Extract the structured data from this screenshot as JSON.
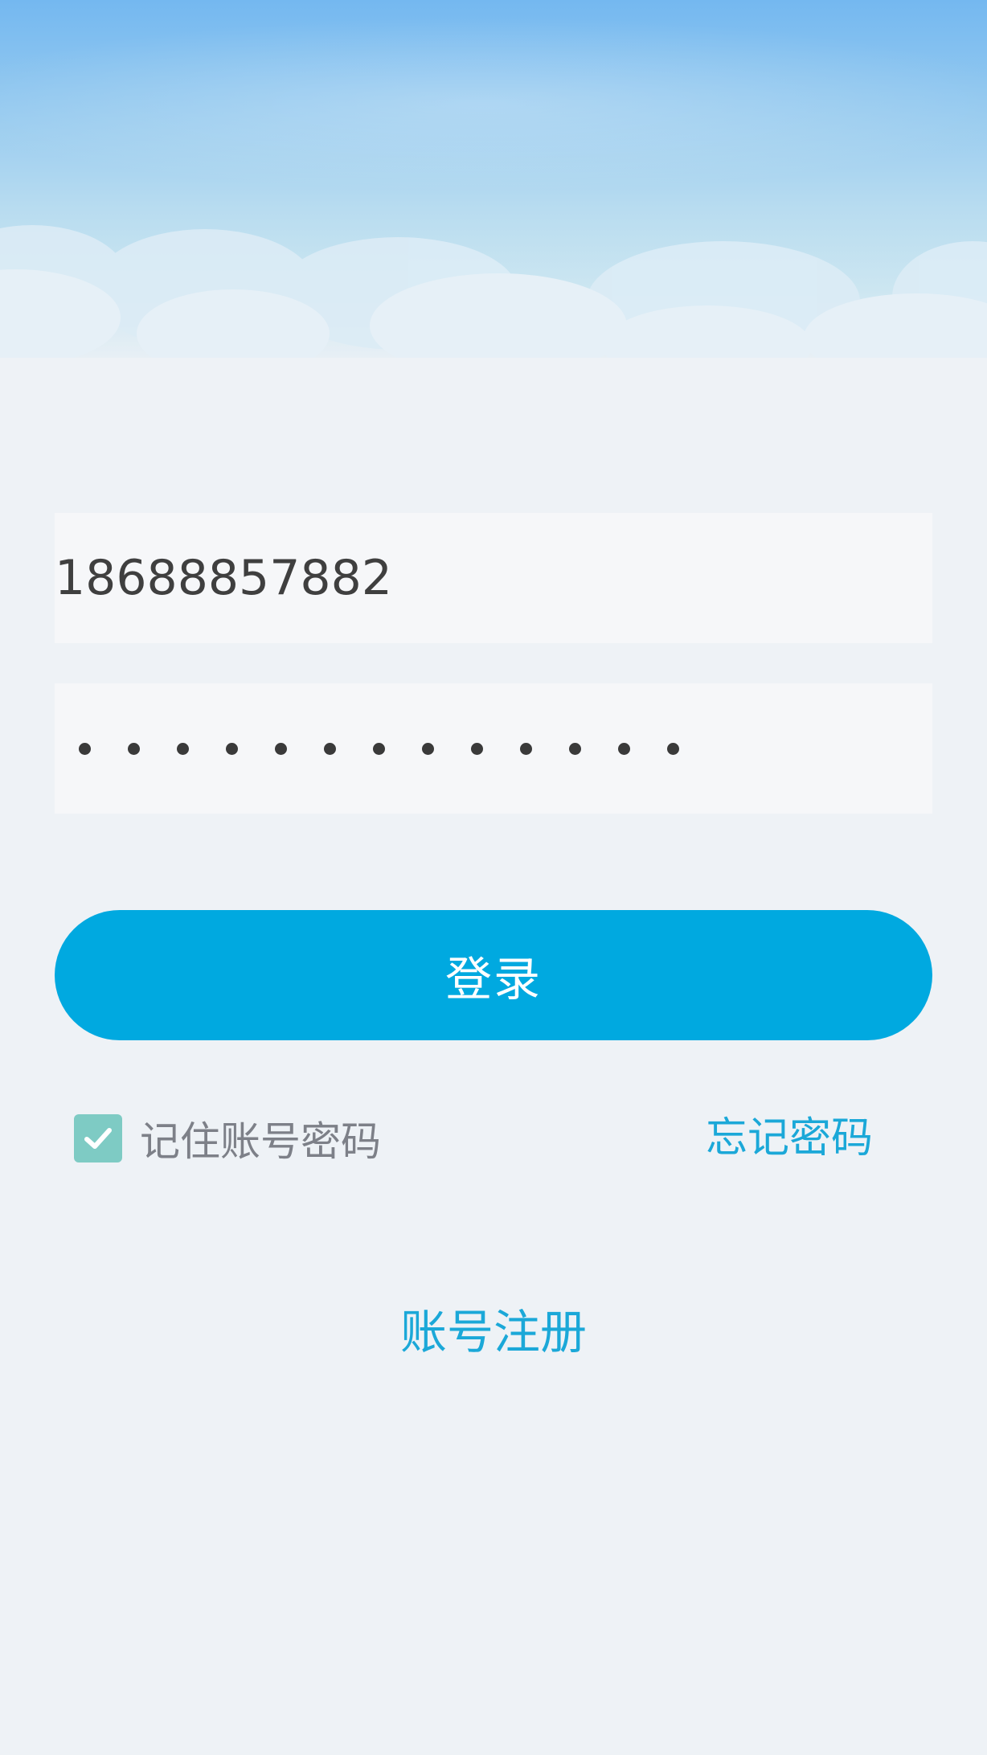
{
  "login_form": {
    "phone_value": "18688857882",
    "password_masked_length": 13,
    "login_button_label": "登录",
    "remember_label": "记住账号密码",
    "remember_checked": true,
    "forgot_password_label": "忘记密码",
    "register_label": "账号注册"
  },
  "colors": {
    "primary": "#00a9e0",
    "link": "#1ba8d8",
    "checkbox": "#7ecbc4",
    "background": "#eef2f6"
  }
}
